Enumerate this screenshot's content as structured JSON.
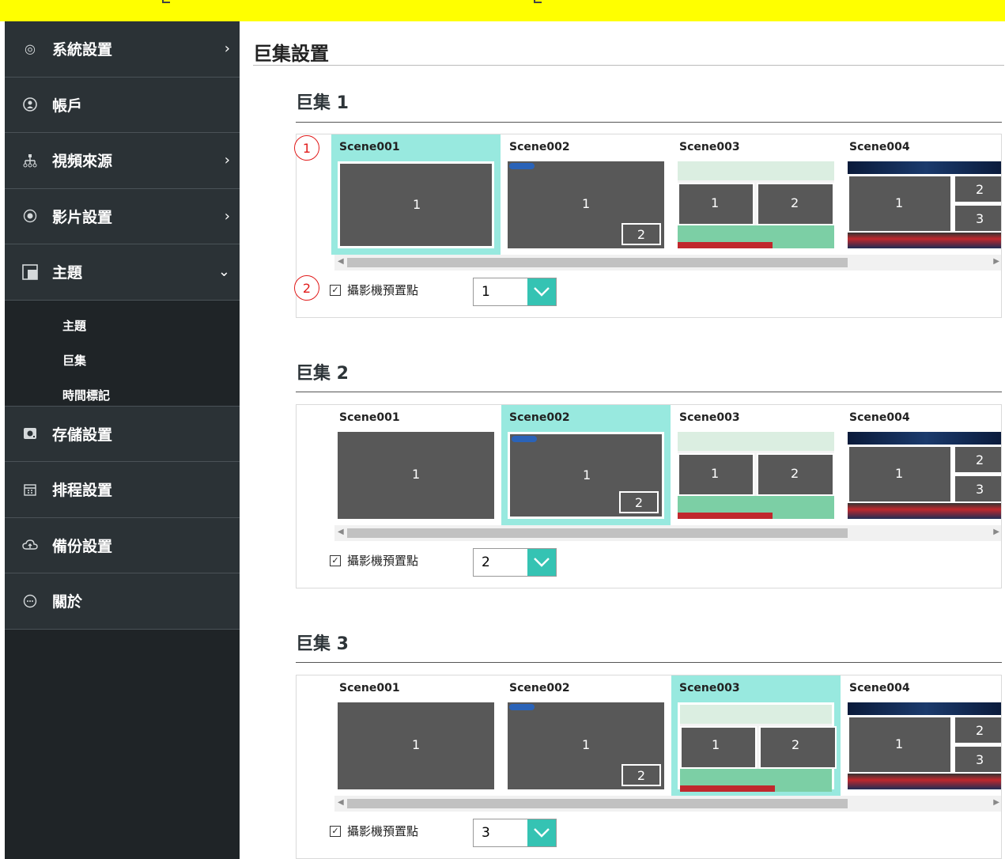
{
  "sidebar": {
    "items": [
      {
        "label": "系統設置",
        "icon": "settings-icon",
        "chevron": "›"
      },
      {
        "label": "帳戶",
        "icon": "user-icon",
        "chevron": ""
      },
      {
        "label": "視頻來源",
        "icon": "network-icon",
        "chevron": "›"
      },
      {
        "label": "影片設置",
        "icon": "record-icon",
        "chevron": "›"
      },
      {
        "label": "主題",
        "icon": "layout-icon",
        "chevron": "⌄"
      }
    ],
    "subitems": [
      "主題",
      "巨集",
      "時間標記"
    ],
    "items_after": [
      {
        "label": "存儲設置",
        "icon": "storage-icon"
      },
      {
        "label": "排程設置",
        "icon": "calendar-icon"
      },
      {
        "label": "備份設置",
        "icon": "cloud-upload-icon"
      },
      {
        "label": "關於",
        "icon": "chat-icon"
      }
    ]
  },
  "page": {
    "title": "巨集設置"
  },
  "macros": [
    {
      "heading": "巨集 1",
      "selected_scene": 1,
      "preset_checked": true,
      "preset_label": "攝影機預置點",
      "preset_value": "1"
    },
    {
      "heading": "巨集 2",
      "selected_scene": 2,
      "preset_checked": true,
      "preset_label": "攝影機預置點",
      "preset_value": "2"
    },
    {
      "heading": "巨集 3",
      "selected_scene": 3,
      "preset_checked": true,
      "preset_label": "攝影機預置點",
      "preset_value": "3"
    }
  ],
  "scenes": {
    "names": [
      "Scene001",
      "Scene002",
      "Scene003",
      "Scene004"
    ],
    "windows": {
      "s1": [
        "1"
      ],
      "s2": [
        "1",
        "2"
      ],
      "s3": [
        "1",
        "2"
      ],
      "s4": [
        "1",
        "2",
        "3"
      ]
    }
  },
  "callouts": [
    "1",
    "2"
  ],
  "colors": {
    "selected": "#98e9df",
    "dropdown": "#35c3b3",
    "callout": "#e11a1a",
    "sidebar": "#2b3236"
  }
}
